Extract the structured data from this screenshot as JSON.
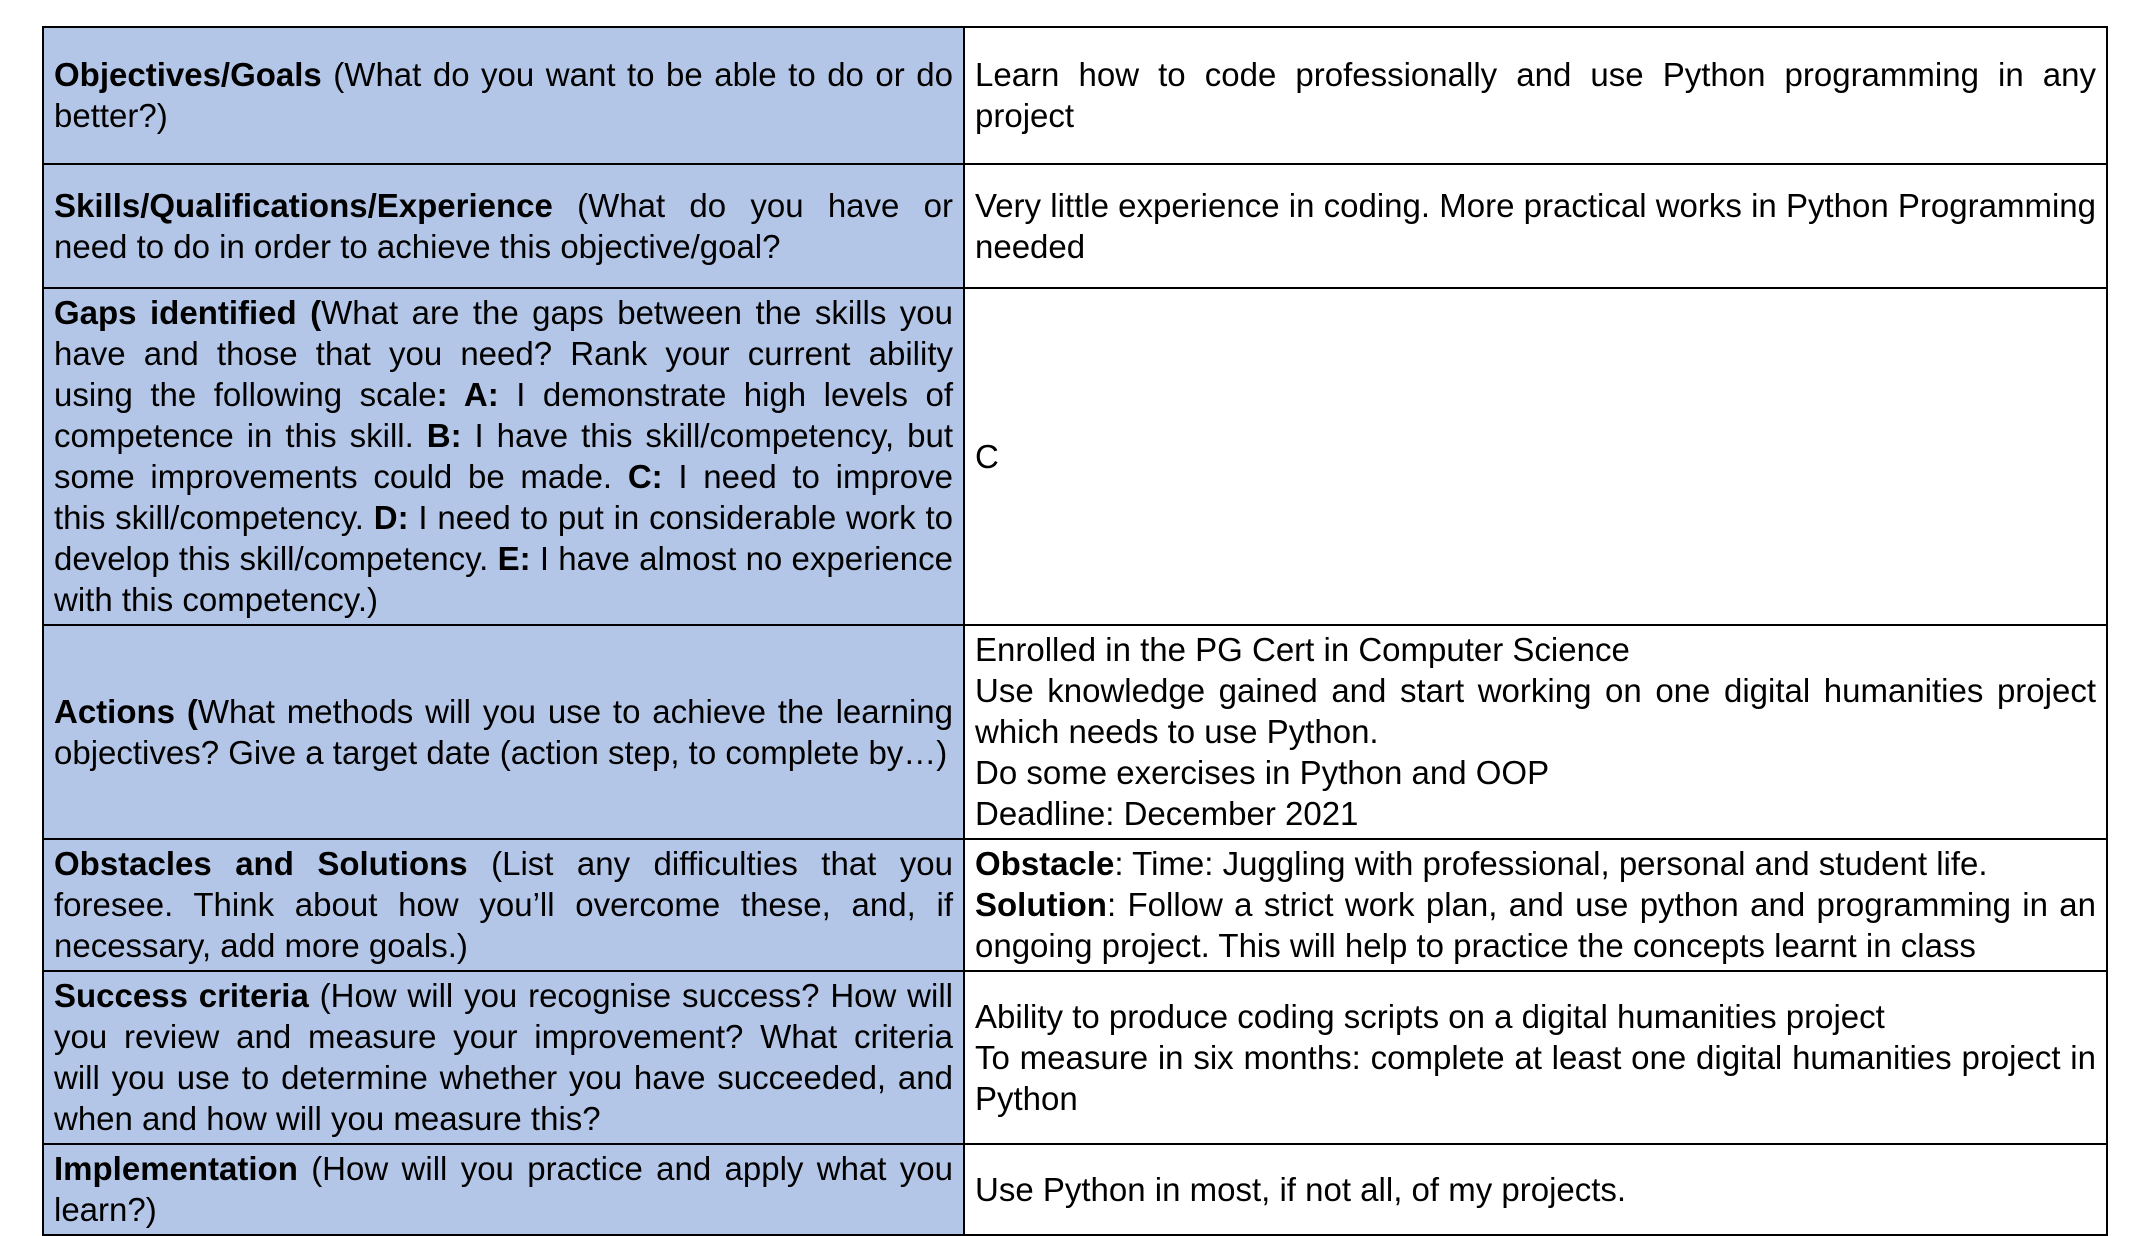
{
  "colors": {
    "label_cell_bg": "#b4c6e7",
    "content_cell_bg": "#ffffff",
    "border": "#000000"
  },
  "rows": [
    {
      "heading": "Objectives/Goals",
      "prompt": " (What do you want to be able to do or do better?)",
      "response": "Learn how to code professionally and use Python programming in any project"
    },
    {
      "heading": "Skills/Qualifications/Experience",
      "prompt": " (What do you have or need to do in order to achieve this objective/goal?",
      "response": "Very little experience in coding. More practical works in Python Programming needed"
    },
    {
      "heading": "Gaps identified (",
      "prompt_parts": [
        "What are the gaps between the skills you have and those that you need? Rank your current ability using the following scale",
        ": A:",
        " I demonstrate high levels of competence in this skill. ",
        "B:",
        " I have this skill/competency, but some improvements could be made. ",
        "C:",
        " I need to improve this skill/competency. ",
        "D:",
        " I need to put in considerable work to develop this skill/competency. ",
        "E:",
        " I have almost no experience with this competency.)"
      ],
      "response": "C"
    },
    {
      "heading": "Actions (",
      "prompt": "What methods will you use to achieve the learning objectives? Give a target date (action step, to complete by…)",
      "response_lines": [
        "Enrolled in the PG Cert in Computer Science",
        "Use knowledge gained and start working on one digital humanities project which needs to use Python.",
        "Do some exercises in Python and OOP",
        "Deadline: December 2021"
      ]
    },
    {
      "heading": "Obstacles and Solutions",
      "prompt": " (List any difficulties that you foresee. Think about how you’ll overcome these, and, if necessary, add more goals.)",
      "obstacle_label": "Obstacle",
      "obstacle_text": ": Time: Juggling with professional, personal and student life.",
      "solution_label": "Solution",
      "solution_text": ": Follow a strict work plan, and use python and programming in an ongoing project. This will help to practice the concepts learnt in class"
    },
    {
      "heading": "Success criteria",
      "prompt": " (How will you recognise success? How will you review and measure your improvement? What criteria will you use to determine whether you have succeeded, and when and how will you measure this?",
      "response_lines": [
        "Ability to produce coding scripts on a digital humanities project",
        "To measure in six months: complete at least one digital humanities project in Python"
      ]
    },
    {
      "heading": "Implementation",
      "prompt": " (How will you practice and apply what you learn?)",
      "response": "Use Python in most, if not all, of my projects."
    }
  ]
}
